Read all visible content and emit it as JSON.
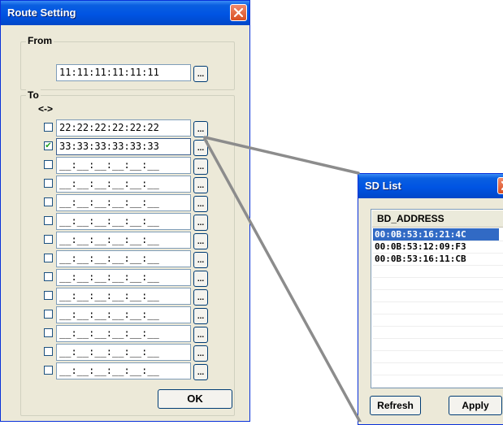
{
  "route_window": {
    "title": "Route Setting",
    "from": {
      "label": "From",
      "address": "11:11:11:11:11:11",
      "browse_label": "..."
    },
    "to": {
      "label": "To",
      "direction_label": "<->",
      "rows": [
        {
          "address": "22:22:22:22:22:22",
          "checked": false,
          "browse_label": "..."
        },
        {
          "address": "33:33:33:33:33:33",
          "checked": true,
          "browse_label": "..."
        },
        {
          "address": "__:__:__:__:__:__",
          "checked": false,
          "browse_label": "..."
        },
        {
          "address": "__:__:__:__:__:__",
          "checked": false,
          "browse_label": "..."
        },
        {
          "address": "__:__:__:__:__:__",
          "checked": false,
          "browse_label": "..."
        },
        {
          "address": "__:__:__:__:__:__",
          "checked": false,
          "browse_label": "..."
        },
        {
          "address": "__:__:__:__:__:__",
          "checked": false,
          "browse_label": "..."
        },
        {
          "address": "__:__:__:__:__:__",
          "checked": false,
          "browse_label": "..."
        },
        {
          "address": "__:__:__:__:__:__",
          "checked": false,
          "browse_label": "..."
        },
        {
          "address": "__:__:__:__:__:__",
          "checked": false,
          "browse_label": "..."
        },
        {
          "address": "__:__:__:__:__:__",
          "checked": false,
          "browse_label": "..."
        },
        {
          "address": "__:__:__:__:__:__",
          "checked": false,
          "browse_label": "..."
        },
        {
          "address": "__:__:__:__:__:__",
          "checked": false,
          "browse_label": "..."
        },
        {
          "address": "__:__:__:__:__:__",
          "checked": false,
          "browse_label": "..."
        }
      ]
    },
    "ok_label": "OK"
  },
  "sd_list_window": {
    "title": "SD List",
    "column_header": "BD_ADDRESS",
    "items": [
      {
        "address": "00:0B:53:16:21:4C",
        "selected": true
      },
      {
        "address": "00:0B:53:12:09:F3",
        "selected": false
      },
      {
        "address": "00:0B:53:16:11:CB",
        "selected": false
      }
    ],
    "refresh_label": "Refresh",
    "apply_label": "Apply"
  },
  "colors": {
    "titlebar": "#0054e3",
    "window_face": "#ece9d8",
    "selection": "#316ac5",
    "connector": "#8c8c8c"
  }
}
